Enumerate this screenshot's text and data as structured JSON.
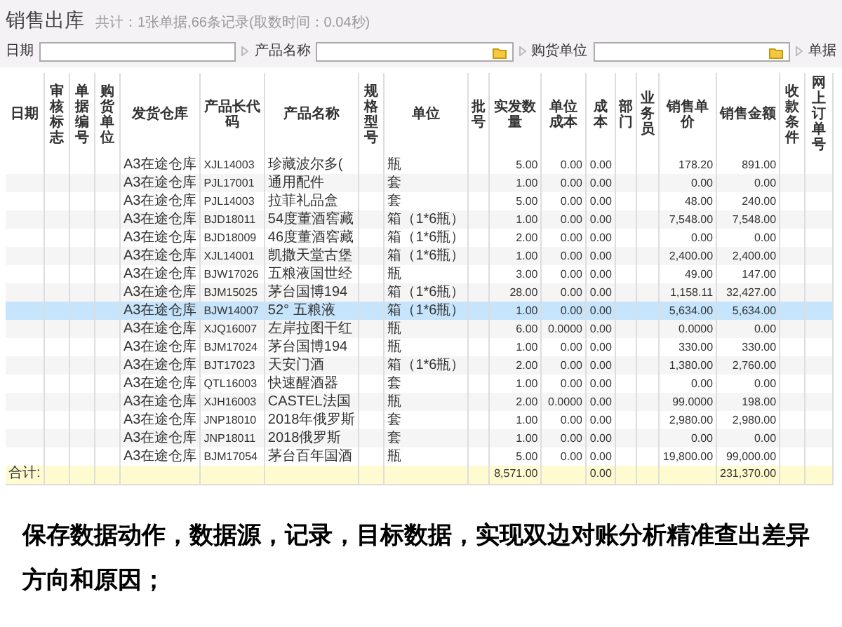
{
  "header": {
    "title": "销售出库",
    "summary": "共计：1张单据,66条记录(取数时间：0.04秒)"
  },
  "filters": [
    {
      "label": "日期",
      "kind": "date"
    },
    {
      "label": "产品名称",
      "kind": "lookup"
    },
    {
      "label": "购货单位",
      "kind": "lookup"
    },
    {
      "label": "单据",
      "kind": "cut"
    }
  ],
  "table": {
    "columns": [
      "日期",
      "审核标志",
      "单据编号",
      "购货单位",
      "发货仓库",
      "产品长代码",
      "产品名称",
      "规格型号",
      "单位",
      "批号",
      "实发数量",
      "单位成本",
      "成本",
      "部门",
      "业务员",
      "销售单价",
      "销售金额",
      "收款条件",
      "网上订单号"
    ],
    "rows": [
      {
        "selected": false,
        "warehouse": "A3在途仓库",
        "code": "XJL14003",
        "name": "珍藏波尔多(",
        "unit": "瓶",
        "qty": "5.00",
        "unit_cost": "0.00",
        "cost": "0.00",
        "price": "178.20",
        "amount": "891.00"
      },
      {
        "selected": false,
        "warehouse": "A3在途仓库",
        "code": "PJL17001",
        "name": "通用配件",
        "unit": "套",
        "qty": "1.00",
        "unit_cost": "0.00",
        "cost": "0.00",
        "price": "0.00",
        "amount": "0.00"
      },
      {
        "selected": false,
        "warehouse": "A3在途仓库",
        "code": "PJL14003",
        "name": "拉菲礼品盒",
        "unit": "套",
        "qty": "5.00",
        "unit_cost": "0.00",
        "cost": "0.00",
        "price": "48.00",
        "amount": "240.00"
      },
      {
        "selected": false,
        "warehouse": "A3在途仓库",
        "code": "BJD18011",
        "name": "54度董酒窖藏",
        "unit": "箱（1*6瓶）",
        "qty": "1.00",
        "unit_cost": "0.00",
        "cost": "0.00",
        "price": "7,548.00",
        "amount": "7,548.00"
      },
      {
        "selected": false,
        "warehouse": "A3在途仓库",
        "code": "BJD18009",
        "name": "46度董酒窖藏",
        "unit": "箱（1*6瓶）",
        "qty": "2.00",
        "unit_cost": "0.00",
        "cost": "0.00",
        "price": "0.00",
        "amount": "0.00"
      },
      {
        "selected": false,
        "warehouse": "A3在途仓库",
        "code": "XJL14001",
        "name": "凯撒天堂古堡",
        "unit": "箱（1*6瓶）",
        "qty": "1.00",
        "unit_cost": "0.00",
        "cost": "0.00",
        "price": "2,400.00",
        "amount": "2,400.00"
      },
      {
        "selected": false,
        "warehouse": "A3在途仓库",
        "code": "BJW17026",
        "name": "五粮液国世经",
        "unit": "瓶",
        "qty": "3.00",
        "unit_cost": "0.00",
        "cost": "0.00",
        "price": "49.00",
        "amount": "147.00"
      },
      {
        "selected": false,
        "warehouse": "A3在途仓库",
        "code": "BJM15025",
        "name": "茅台国博194",
        "unit": "箱（1*6瓶）",
        "qty": "28.00",
        "unit_cost": "0.00",
        "cost": "0.00",
        "price": "1,158.11",
        "amount": "32,427.00"
      },
      {
        "selected": true,
        "warehouse": "A3在途仓库",
        "code": "BJW14007",
        "name": "52° 五粮液",
        "unit": "箱（1*6瓶）",
        "qty": "1.00",
        "unit_cost": "0.00",
        "cost": "0.00",
        "price": "5,634.00",
        "amount": "5,634.00"
      },
      {
        "selected": false,
        "warehouse": "A3在途仓库",
        "code": "XJQ16007",
        "name": "左岸拉图干红",
        "unit": "瓶",
        "qty": "6.00",
        "unit_cost": "0.0000",
        "cost": "0.00",
        "price": "0.0000",
        "amount": "0.00"
      },
      {
        "selected": false,
        "warehouse": "A3在途仓库",
        "code": "BJM17024",
        "name": "茅台国博194",
        "unit": "瓶",
        "qty": "1.00",
        "unit_cost": "0.00",
        "cost": "0.00",
        "price": "330.00",
        "amount": "330.00"
      },
      {
        "selected": false,
        "warehouse": "A3在途仓库",
        "code": "BJT17023",
        "name": "天安门酒",
        "unit": "箱（1*6瓶）",
        "qty": "2.00",
        "unit_cost": "0.00",
        "cost": "0.00",
        "price": "1,380.00",
        "amount": "2,760.00"
      },
      {
        "selected": false,
        "warehouse": "A3在途仓库",
        "code": "QTL16003",
        "name": "快速醒酒器",
        "unit": "套",
        "qty": "1.00",
        "unit_cost": "0.00",
        "cost": "0.00",
        "price": "0.00",
        "amount": "0.00"
      },
      {
        "selected": false,
        "warehouse": "A3在途仓库",
        "code": "XJH16003",
        "name": "CASTEL法国",
        "unit": "瓶",
        "qty": "2.00",
        "unit_cost": "0.0000",
        "cost": "0.00",
        "price": "99.0000",
        "amount": "198.00"
      },
      {
        "selected": false,
        "warehouse": "A3在途仓库",
        "code": "JNP18010",
        "name": "2018年俄罗斯",
        "unit": "套",
        "qty": "1.00",
        "unit_cost": "0.00",
        "cost": "0.00",
        "price": "2,980.00",
        "amount": "2,980.00"
      },
      {
        "selected": false,
        "warehouse": "A3在途仓库",
        "code": "JNP18011",
        "name": "2018俄罗斯",
        "unit": "套",
        "qty": "1.00",
        "unit_cost": "0.00",
        "cost": "0.00",
        "price": "0.00",
        "amount": "0.00"
      },
      {
        "selected": false,
        "warehouse": "A3在途仓库",
        "code": "BJM17054",
        "name": "茅台百年国酒",
        "unit": "瓶",
        "qty": "5.00",
        "unit_cost": "0.00",
        "cost": "0.00",
        "price": "19,800.00",
        "amount": "99,000.00"
      }
    ],
    "total": {
      "label": "合计:",
      "qty": "8,571.00",
      "cost": "0.00",
      "amount": "231,370.00"
    }
  },
  "caption": "保存数据动作，数据源，记录，目标数据，实现双边对账分析精准查出差异方向和原因；"
}
